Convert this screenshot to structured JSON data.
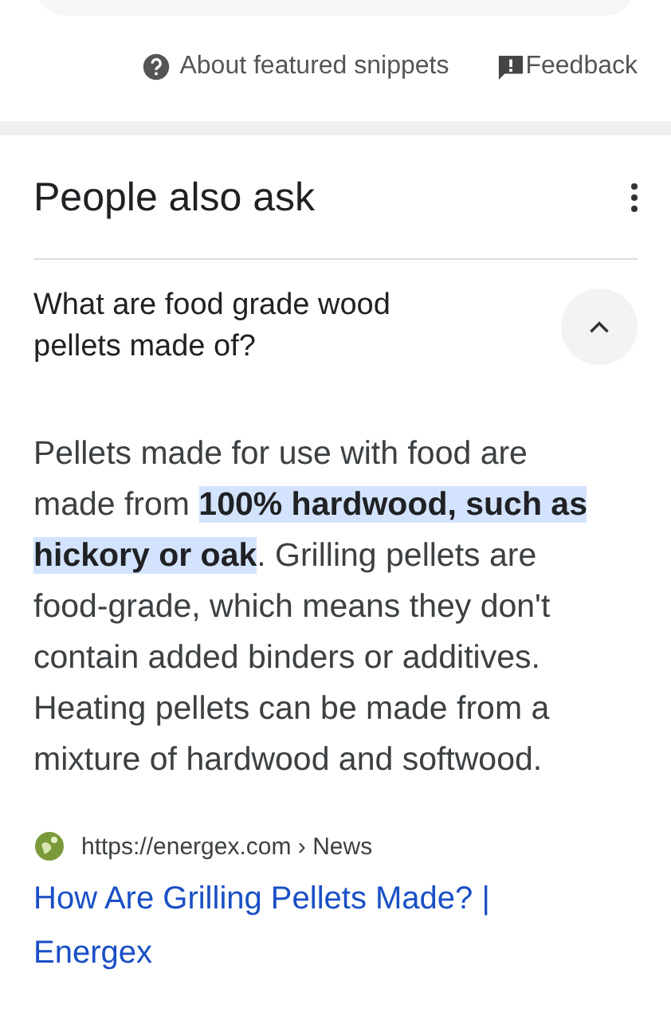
{
  "snippet_footer": {
    "about_label": "About featured snippets",
    "feedback_label": "Feedback"
  },
  "people_also_ask": {
    "title": "People also ask",
    "questions": [
      {
        "question": "What are food grade wood pellets made of?",
        "expanded": true,
        "answer": "Pellets made for use with food are made from **100% hardwood, such as hickory or oak**. Grilling pellets are food-grade, which means they don't contain added binders or additives. Heating pellets can be made from a mixture of hardwood and softwood.",
        "source_url": "https://energex.com › News",
        "link_title": "How Are Grilling Pellets Made? | Energex"
      }
    ]
  }
}
